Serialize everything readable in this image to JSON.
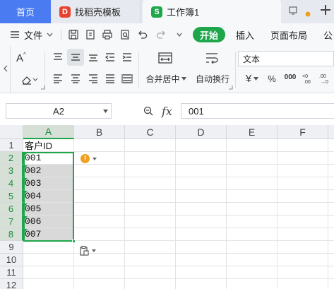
{
  "tabs": {
    "home": "首页",
    "template": "找稻壳模板",
    "template_logo": "D",
    "doc": "工作簿1",
    "doc_logo": "S"
  },
  "menu": {
    "file": "文件",
    "start": "开始",
    "insert": "插入",
    "page_layout": "页面布局",
    "formula_truncated": "公"
  },
  "ribbon": {
    "merge_center": "合并居中",
    "auto_wrap": "自动换行",
    "number_format": "文本",
    "currency_symbol": "¥",
    "percent_symbol": "%",
    "thousands_symbol": "000"
  },
  "formula_bar": {
    "name_box": "A2",
    "fx_label": "fx",
    "content": "001"
  },
  "grid": {
    "columns": [
      "A",
      "B",
      "C",
      "D",
      "E",
      "F"
    ],
    "rows": [
      "1",
      "2",
      "3",
      "4",
      "5",
      "6",
      "7",
      "8",
      "9",
      "10",
      "11",
      "12"
    ],
    "cells_a": [
      "客户ID",
      "001",
      "002",
      "003",
      "004",
      "005",
      "006",
      "007"
    ]
  },
  "colors": {
    "accent_green": "#1da64a",
    "home_tab_blue": "#4a7bf0",
    "warning_orange": "#f0a020"
  }
}
